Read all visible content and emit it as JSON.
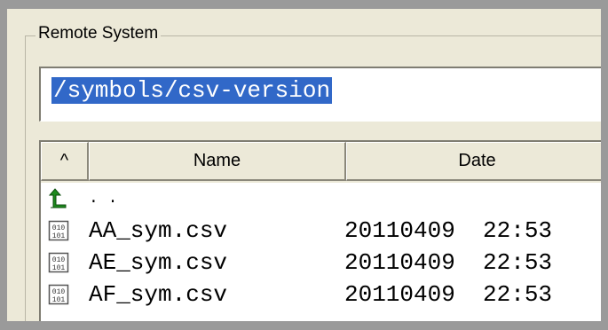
{
  "panel": {
    "title": "Remote System",
    "path_value": "/symbols/csv-version"
  },
  "list": {
    "columns": [
      {
        "label": "^"
      },
      {
        "label": "Name"
      },
      {
        "label": "Date"
      }
    ],
    "up_item": {
      "name": ". .",
      "icon": "folder-up-arrow-icon"
    },
    "files": [
      {
        "name": "AA_sym.csv",
        "date": "20110409  22:53",
        "icon": "binary-file-icon"
      },
      {
        "name": "AE_sym.csv",
        "date": "20110409  22:53",
        "icon": "binary-file-icon"
      },
      {
        "name": "AF_sym.csv",
        "date": "20110409  22:53",
        "icon": "binary-file-icon"
      }
    ]
  },
  "colors": {
    "selection": "#3168c8",
    "up_arrow": "#1e8a1e"
  }
}
